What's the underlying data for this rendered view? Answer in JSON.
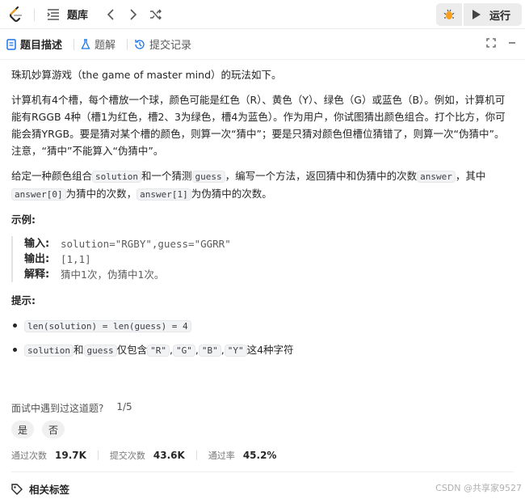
{
  "topbar": {
    "problem_bank_label": "题库",
    "run_label": "运行"
  },
  "tabs": [
    {
      "label": "题目描述"
    },
    {
      "label": "题解"
    },
    {
      "label": "提交记录"
    }
  ],
  "description": {
    "intro": "珠玑妙算游戏（the game of master mind）的玩法如下。",
    "rules": "计算机有4个槽，每个槽放一个球，颜色可能是红色（R）、黄色（Y）、绿色（G）或蓝色（B）。例如，计算机可能有RGGB 4种（槽1为红色，槽2、3为绿色，槽4为蓝色）。作为用户，你试图猜出颜色组合。打个比方，你可能会猜YRGB。要是猜对某个槽的颜色，则算一次“猜中”；要是只猜对颜色但槽位猜错了，则算一次“伪猜中”。注意，“猜中”不能算入“伪猜中”。",
    "task": {
      "t1": "给定一种颜色组合",
      "c1": "solution",
      "t2": "和一个猜测",
      "c2": "guess",
      "t3": "，编写一个方法，返回猜中和伪猜中的次数",
      "c3": "answer",
      "t4": "，其中",
      "c4": "answer[0]",
      "t5": "为猜中的次数，",
      "c5": "answer[1]",
      "t6": "为伪猜中的次数。"
    }
  },
  "example": {
    "title": "示例:",
    "input_label": "输入:",
    "input_value": "solution=\"RGBY\",guess=\"GGRR\"",
    "output_label": "输出:",
    "output_value": "[1,1]",
    "explain_label": "解释:",
    "explain_value": "猜中1次，伪猜中1次。"
  },
  "hints": {
    "title": "提示:",
    "h1_code": "len(solution) = len(guess) = 4",
    "h2_code1": "solution",
    "h2_t1": "和",
    "h2_code2": "guess",
    "h2_t2": "仅包含",
    "h2_code3": "\"R\"",
    "h2_code4": "\"G\"",
    "h2_code5": "\"B\"",
    "h2_code6": "\"Y\"",
    "h2_t3": "这4种字符",
    "comma": ","
  },
  "survey": {
    "question": "面试中遇到过这道题?",
    "progress": "1/5",
    "yes": "是",
    "no": "否"
  },
  "stats": [
    {
      "label": "通过次数",
      "value": "19.7K"
    },
    {
      "label": "提交次数",
      "value": "43.6K"
    },
    {
      "label": "通过率",
      "value": "45.2%"
    }
  ],
  "tags_label": "相关标签",
  "watermark": "CSDN @共享家9527",
  "colors": {
    "accent_blue": "#1a73e8",
    "logo_orange": "#f89f1b",
    "logo_dark": "#2b2b2b"
  }
}
